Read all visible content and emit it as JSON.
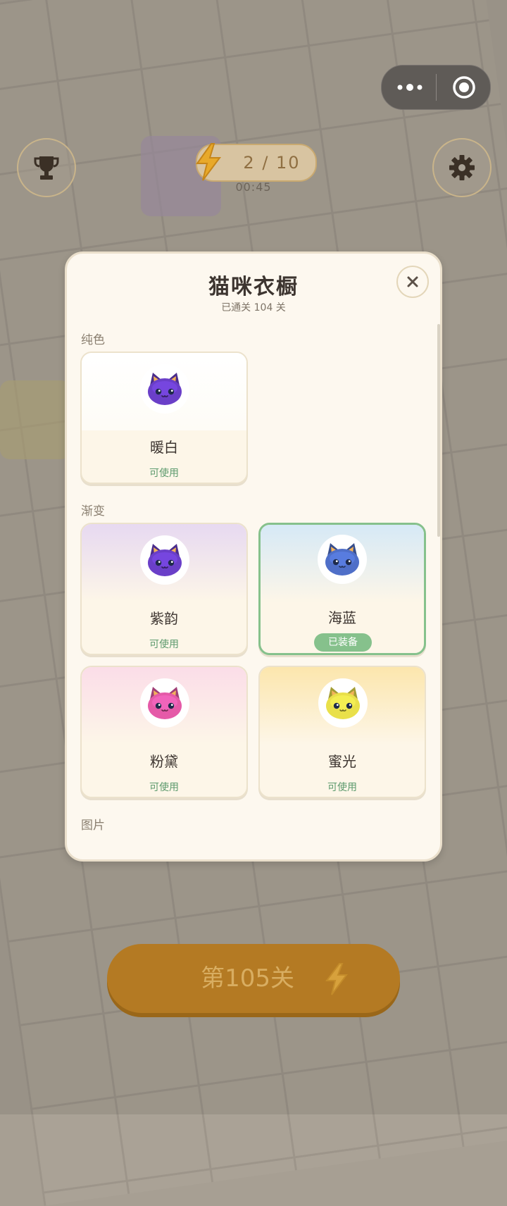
{
  "hud": {
    "energy_text": "2 / 10",
    "timer": "00:45"
  },
  "modal": {
    "title": "猫咪衣橱",
    "subtitle": "已通关 104 关",
    "close_symbol": "✕",
    "sections": {
      "solid": "纯色",
      "gradient": "渐变",
      "image": "图片"
    },
    "cards": [
      {
        "name": "暖白",
        "status": "可使用",
        "cat_color": "#6a3fc8",
        "top_color": "#ffffff"
      },
      {
        "name": "紫韵",
        "status": "可使用",
        "cat_color": "#6a3fc8",
        "top_color": "#eadcf3"
      },
      {
        "name": "海蓝",
        "status": "已装备",
        "cat_color": "#4f6fc8",
        "top_color": "#d9ebf7"
      },
      {
        "name": "粉黛",
        "status": "可使用",
        "cat_color": "#e55aa8",
        "top_color": "#fbe0ea"
      },
      {
        "name": "蜜光",
        "status": "可使用",
        "cat_color": "#e9e04a",
        "top_color": "#fdeab5"
      }
    ]
  },
  "start_button": {
    "label": "第105关"
  },
  "icons": {
    "menu": "more-dots-icon",
    "capsule_close": "target-circle-icon",
    "rank": "trophy-icon",
    "settings": "gear-icon",
    "energy": "lightning-icon"
  }
}
